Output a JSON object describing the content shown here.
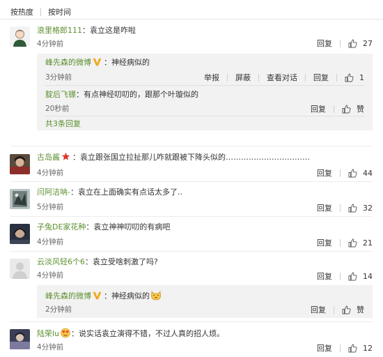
{
  "sort_tabs": {
    "hot": "按热度",
    "time": "按时间"
  },
  "labels": {
    "reply": "回复",
    "report": "举报",
    "block": "屏蔽",
    "view_conversation": "查看对话",
    "like": "赞"
  },
  "comments": [
    {
      "user": "浪里格郎111",
      "text": "：袁立这是咋啦",
      "time": "4分钟前",
      "likes": "27"
    },
    {
      "user": "古岛酱",
      "text": "：袁立跟张国立拉扯那儿咋就跟被下降头似的……………………………",
      "time": "4分钟前",
      "likes": "44"
    },
    {
      "user": "闫阿洁呐-",
      "text": "：袁立在上面确实有点话太多了..",
      "time": "5分钟前",
      "likes": "32"
    },
    {
      "user": "子兔DE家花种",
      "text": "：袁立神神叨叨的有病吧",
      "time": "4分钟前",
      "likes": "21"
    },
    {
      "user": "云淡风轻6个6",
      "text": "：袁立受啥刺激了吗?",
      "time": "4分钟前",
      "likes": "14"
    },
    {
      "user": "陆荣lu",
      "text": "：说实话袁立演得不错，不过人真的招人烦。",
      "time": "4分钟前",
      "likes": "12"
    }
  ],
  "replies_1": [
    {
      "user": "峰先森的微博",
      "text": "：神经病似的",
      "time": "3分钟前",
      "likes": "1"
    },
    {
      "user": "腚后飞镖",
      "text": "：有点神经叨叨的，跟那个叶璇似的",
      "time": "20秒前"
    }
  ],
  "replies_1_more": "共3条回复",
  "replies_5": [
    {
      "user": "峰先森的微博",
      "text": "：神经病似的",
      "time": "2分钟前"
    }
  ],
  "colors": {
    "username": "#5c8f2f",
    "reply_bg": "#f2f2f2",
    "vip_badge": "#f0a81c"
  },
  "icons": [
    "thumbs-up-icon",
    "vip-v-badge-icon",
    "red-star-icon",
    "heart-face-emoji-icon",
    "smile-cat-emoji-icon"
  ]
}
